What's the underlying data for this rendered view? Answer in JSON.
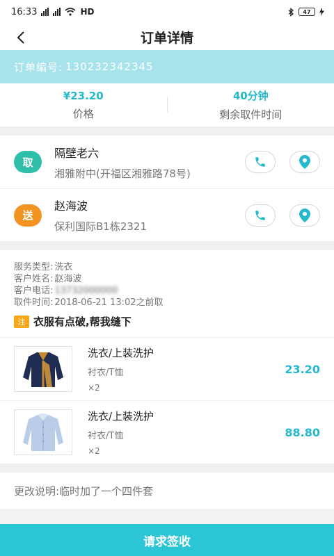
{
  "status_bar": {
    "time": "16:33",
    "network": "HD",
    "battery": "47"
  },
  "nav": {
    "title": "订单详情"
  },
  "order": {
    "label": "订单编号:",
    "number": "130232342345"
  },
  "summary": {
    "price_value": "¥23.20",
    "price_label": "价格",
    "time_value": "40分钟",
    "time_label": "剩余取件时间"
  },
  "pickup": {
    "badge": "取",
    "name": "隔壁老六",
    "address": "湘雅附中(开福区湘雅路78号)"
  },
  "delivery": {
    "badge": "送",
    "name": "赵海波",
    "address": "保利国际B1栋2321"
  },
  "info": {
    "service_label": "服务类型:",
    "service_value": "洗衣",
    "customer_label": "客户姓名:",
    "customer_value": "赵海波",
    "phone_label": "客户电话:",
    "phone_value": "13732000000",
    "time_label": "取件时间:",
    "time_value": "2018-06-21 13:02之前取",
    "note_tag": "注",
    "note_text": "衣服有点破,帮我缝下"
  },
  "items": [
    {
      "title": "洗衣/上装洗护",
      "sub": "衬衣/T恤",
      "qty": "×2",
      "price": "23.20",
      "icon": "jacket-icon"
    },
    {
      "title": "洗衣/上装洗护",
      "sub": "衬衣/T恤",
      "qty": "×2",
      "price": "88.80",
      "icon": "shirt-icon"
    }
  ],
  "remark": {
    "text": "更改说明:临时加了一个四件套"
  },
  "footer": {
    "button_label": "请求签收"
  },
  "colors": {
    "accent": "#2bc5d6",
    "order_bar": "#a7e3ea",
    "pickup": "#2fbfa8",
    "delivery": "#f39422",
    "note": "#f8a81b"
  }
}
